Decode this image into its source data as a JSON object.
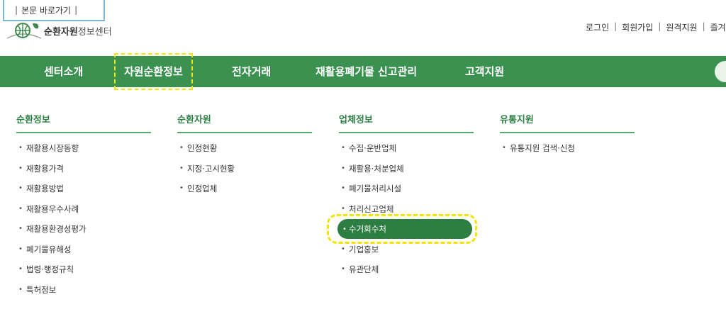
{
  "skip_link": "본문 바로가기",
  "logo": {
    "name_bold": "순환자원",
    "name_rest": "정보센터"
  },
  "util_links": [
    "로그인",
    "회원가입",
    "원격지원",
    "즐겨찾기"
  ],
  "gnb": [
    "센터소개",
    "자원순환정보",
    "전자거래",
    "재활용폐기물 신고관리",
    "고객지원"
  ],
  "columns": [
    {
      "title": "순환정보",
      "items": [
        "재활용시장동향",
        "재활용가격",
        "재활용방법",
        "재활용우수사례",
        "재활용환경성평가",
        "폐기물유해성",
        "법령·행정규칙",
        "특허정보"
      ]
    },
    {
      "title": "순환자원",
      "items": [
        "인정현황",
        "지정·고시현황",
        "인정업체"
      ]
    },
    {
      "title": "업체정보",
      "items": [
        "수집·운반업체",
        "재활용·처분업체",
        "폐기물처리시설",
        "처리신고업체",
        "수거회수처",
        "기업홍보",
        "유관단체"
      ]
    },
    {
      "title": "유통지원",
      "items": [
        "유통지원 검색·신청"
      ]
    }
  ],
  "colors": {
    "gnb_bg": "#3a9150",
    "active_pill": "#2e7d43",
    "highlight": "#f2e400"
  }
}
